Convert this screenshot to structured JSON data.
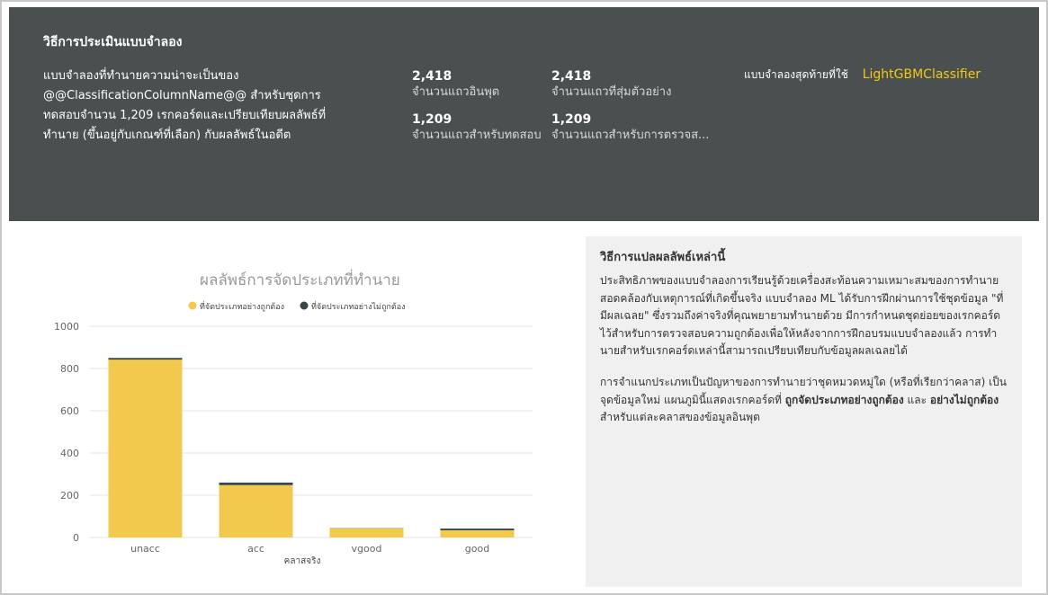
{
  "header": {
    "title": "วิธีการประเมินแบบจำลอง",
    "description": "แบบจำลองที่ทำนายความน่าจะเป็นของ @@ClassificationColumnName@@ สำหรับชุดการทดสอบจำนวน 1,209 เรกคอร์ดและเปรียบเทียบผลลัพธ์ที่ทำนาย (ขึ้นอยู่กับเกณฑ์ที่เลือก) กับผลลัพธ์ในอดีต",
    "stats": [
      {
        "value": "2,418",
        "label": "จำนวนแถวอินพุต"
      },
      {
        "value": "2,418",
        "label": "จำนวนแถวที่สุ่มตัวอย่าง"
      },
      {
        "value": "1,209",
        "label": "จำนวนแถวสำหรับทดสอบ"
      },
      {
        "value": "1,209",
        "label": "จำนวนแถวสำหรับการตรวจส..."
      }
    ],
    "final_model_label": "แบบจำลองสุดท้ายที่ใช้",
    "final_model_value": "LightGBMClassifier"
  },
  "info": {
    "title": "วิธีการแปลผลลัพธ์เหล่านี้",
    "para1": "ประสิทธิภาพของแบบจำลองการเรียนรู้ด้วยเครื่องสะท้อนความเหมาะสมของการทำนายสอดคล้องกับเหตุการณ์ที่เกิดขึ้นจริง แบบจำลอง ML ได้รับการฝึกผ่านการใช้ชุดข้อมูล \"ที่มีผลเฉลย\" ซึ่งรวมถึงค่าจริงที่คุณพยายามทำนายด้วย มีการกำหนดชุดย่อยของเรกคอร์ดไว้สำหรับการตรวจสอบความถูกต้องเพื่อให้หลังจากการฝึกอบรมแบบจำลองแล้ว การทำนายสำหรับเรกคอร์ดเหล่านี้สามารถเปรียบเทียบกับข้อมูลผลเฉลยได้",
    "para2_a": "การจำแนกประเภทเป็นปัญหาของการทำนายว่าชุดหมวดหมู่ใด (หรือที่เรียกว่าคลาส) เป็นจุดข้อมูลใหม่ แผนภูมินี้แสดงเรกคอร์ดที่ ",
    "para2_b": "ถูกจัดประเภทอย่างถูกต้อง",
    "para2_c": " และ ",
    "para2_d": "อย่างไม่ถูกต้อง",
    "para2_e": " สำหรับแต่ละคลาสของข้อมูลอินพุต"
  },
  "colors": {
    "correct": "#f2c94c",
    "incorrect": "#374649",
    "header_bg": "#4a5050",
    "accent": "#f2c811"
  },
  "chart_data": {
    "type": "bar",
    "stacked": true,
    "title": "ผลลัพธ์การจัดประเภทที่ทำนาย",
    "xlabel": "คลาสจริง",
    "ylabel": "",
    "categories": [
      "unacc",
      "acc",
      "vgood",
      "good"
    ],
    "series": [
      {
        "name": "ที่จัดประเภทอย่างถูกต้อง",
        "values": [
          842,
          248,
          44,
          34
        ]
      },
      {
        "name": "ที่จัดประเภทอย่างไม่ถูกต้อง",
        "values": [
          8,
          12,
          1,
          8
        ]
      }
    ],
    "ylim": [
      0,
      1000
    ],
    "yticks": [
      0,
      200,
      400,
      600,
      800,
      1000
    ],
    "grid": true,
    "legend": "top"
  }
}
